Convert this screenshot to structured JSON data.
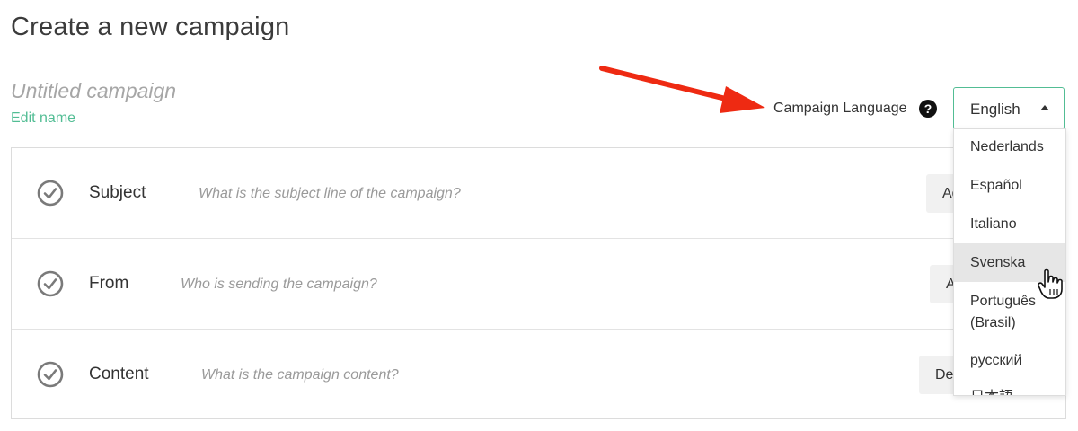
{
  "page": {
    "title": "Create a new campaign"
  },
  "campaign": {
    "name": "Untitled campaign",
    "edit_name_label": "Edit name"
  },
  "language": {
    "label": "Campaign Language",
    "help_icon": "question-circle-icon",
    "selected": "English",
    "options": [
      "Nederlands",
      "Español",
      "Italiano",
      "Svenska",
      "Português (Brasil)",
      "русский",
      "日本語"
    ],
    "highlighted": "Svenska"
  },
  "steps": [
    {
      "title": "Subject",
      "hint": "What is the subject line of the campaign?",
      "button_label": "Add subject",
      "icon": "check-circle-icon"
    },
    {
      "title": "From",
      "hint": "Who is sending the campaign?",
      "button_label": "Add from",
      "icon": "check-circle-icon"
    },
    {
      "title": "Content",
      "hint": "What is the campaign content?",
      "button_label": "Design email",
      "icon": "check-circle-icon"
    }
  ],
  "colors": {
    "accent_green": "#52bd94",
    "annotation_red": "#ee2a12",
    "highlight_gray": "#e6e6e6"
  }
}
